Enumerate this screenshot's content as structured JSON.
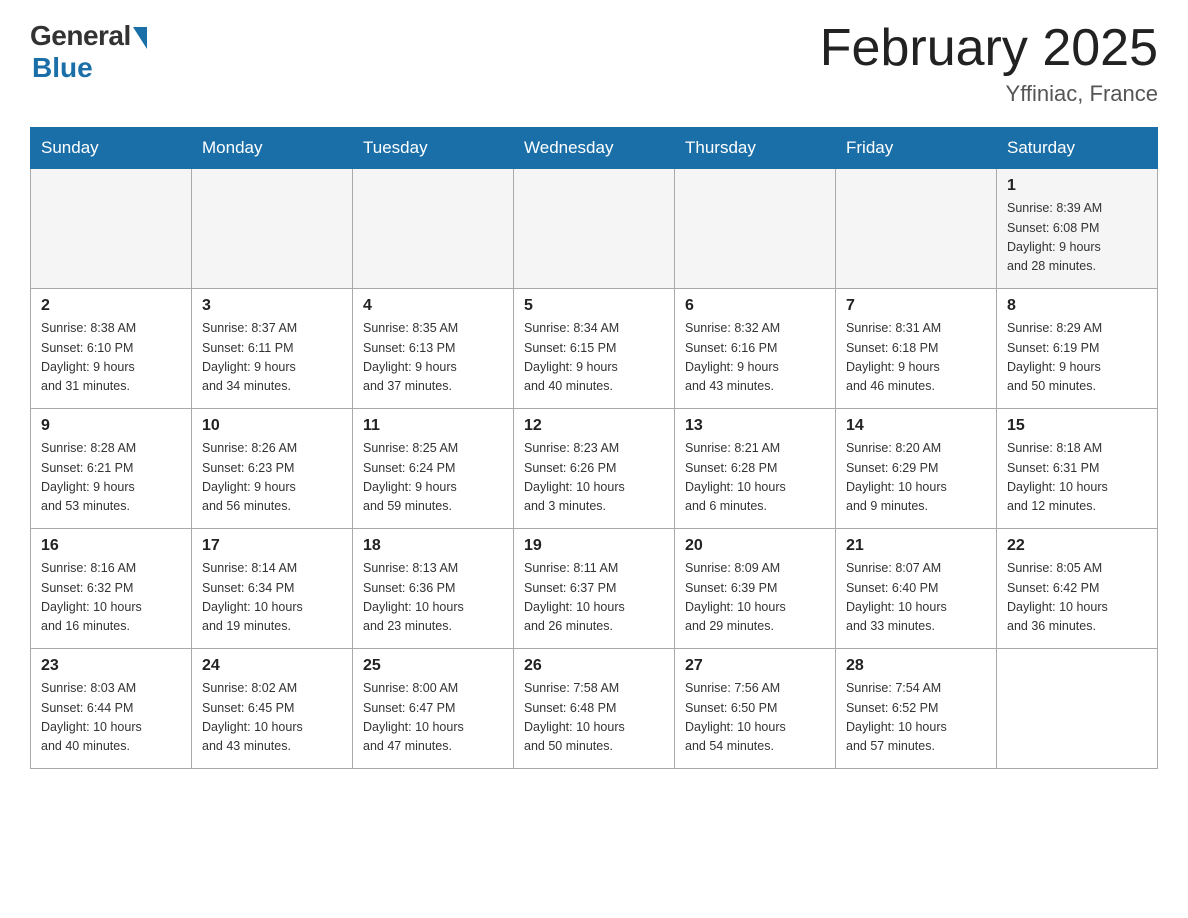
{
  "header": {
    "logo_general": "General",
    "logo_blue": "Blue",
    "month_title": "February 2025",
    "location": "Yffiniac, France"
  },
  "days_of_week": [
    "Sunday",
    "Monday",
    "Tuesday",
    "Wednesday",
    "Thursday",
    "Friday",
    "Saturday"
  ],
  "weeks": [
    {
      "days": [
        {
          "number": "",
          "info": ""
        },
        {
          "number": "",
          "info": ""
        },
        {
          "number": "",
          "info": ""
        },
        {
          "number": "",
          "info": ""
        },
        {
          "number": "",
          "info": ""
        },
        {
          "number": "",
          "info": ""
        },
        {
          "number": "1",
          "info": "Sunrise: 8:39 AM\nSunset: 6:08 PM\nDaylight: 9 hours\nand 28 minutes."
        }
      ]
    },
    {
      "days": [
        {
          "number": "2",
          "info": "Sunrise: 8:38 AM\nSunset: 6:10 PM\nDaylight: 9 hours\nand 31 minutes."
        },
        {
          "number": "3",
          "info": "Sunrise: 8:37 AM\nSunset: 6:11 PM\nDaylight: 9 hours\nand 34 minutes."
        },
        {
          "number": "4",
          "info": "Sunrise: 8:35 AM\nSunset: 6:13 PM\nDaylight: 9 hours\nand 37 minutes."
        },
        {
          "number": "5",
          "info": "Sunrise: 8:34 AM\nSunset: 6:15 PM\nDaylight: 9 hours\nand 40 minutes."
        },
        {
          "number": "6",
          "info": "Sunrise: 8:32 AM\nSunset: 6:16 PM\nDaylight: 9 hours\nand 43 minutes."
        },
        {
          "number": "7",
          "info": "Sunrise: 8:31 AM\nSunset: 6:18 PM\nDaylight: 9 hours\nand 46 minutes."
        },
        {
          "number": "8",
          "info": "Sunrise: 8:29 AM\nSunset: 6:19 PM\nDaylight: 9 hours\nand 50 minutes."
        }
      ]
    },
    {
      "days": [
        {
          "number": "9",
          "info": "Sunrise: 8:28 AM\nSunset: 6:21 PM\nDaylight: 9 hours\nand 53 minutes."
        },
        {
          "number": "10",
          "info": "Sunrise: 8:26 AM\nSunset: 6:23 PM\nDaylight: 9 hours\nand 56 minutes."
        },
        {
          "number": "11",
          "info": "Sunrise: 8:25 AM\nSunset: 6:24 PM\nDaylight: 9 hours\nand 59 minutes."
        },
        {
          "number": "12",
          "info": "Sunrise: 8:23 AM\nSunset: 6:26 PM\nDaylight: 10 hours\nand 3 minutes."
        },
        {
          "number": "13",
          "info": "Sunrise: 8:21 AM\nSunset: 6:28 PM\nDaylight: 10 hours\nand 6 minutes."
        },
        {
          "number": "14",
          "info": "Sunrise: 8:20 AM\nSunset: 6:29 PM\nDaylight: 10 hours\nand 9 minutes."
        },
        {
          "number": "15",
          "info": "Sunrise: 8:18 AM\nSunset: 6:31 PM\nDaylight: 10 hours\nand 12 minutes."
        }
      ]
    },
    {
      "days": [
        {
          "number": "16",
          "info": "Sunrise: 8:16 AM\nSunset: 6:32 PM\nDaylight: 10 hours\nand 16 minutes."
        },
        {
          "number": "17",
          "info": "Sunrise: 8:14 AM\nSunset: 6:34 PM\nDaylight: 10 hours\nand 19 minutes."
        },
        {
          "number": "18",
          "info": "Sunrise: 8:13 AM\nSunset: 6:36 PM\nDaylight: 10 hours\nand 23 minutes."
        },
        {
          "number": "19",
          "info": "Sunrise: 8:11 AM\nSunset: 6:37 PM\nDaylight: 10 hours\nand 26 minutes."
        },
        {
          "number": "20",
          "info": "Sunrise: 8:09 AM\nSunset: 6:39 PM\nDaylight: 10 hours\nand 29 minutes."
        },
        {
          "number": "21",
          "info": "Sunrise: 8:07 AM\nSunset: 6:40 PM\nDaylight: 10 hours\nand 33 minutes."
        },
        {
          "number": "22",
          "info": "Sunrise: 8:05 AM\nSunset: 6:42 PM\nDaylight: 10 hours\nand 36 minutes."
        }
      ]
    },
    {
      "days": [
        {
          "number": "23",
          "info": "Sunrise: 8:03 AM\nSunset: 6:44 PM\nDaylight: 10 hours\nand 40 minutes."
        },
        {
          "number": "24",
          "info": "Sunrise: 8:02 AM\nSunset: 6:45 PM\nDaylight: 10 hours\nand 43 minutes."
        },
        {
          "number": "25",
          "info": "Sunrise: 8:00 AM\nSunset: 6:47 PM\nDaylight: 10 hours\nand 47 minutes."
        },
        {
          "number": "26",
          "info": "Sunrise: 7:58 AM\nSunset: 6:48 PM\nDaylight: 10 hours\nand 50 minutes."
        },
        {
          "number": "27",
          "info": "Sunrise: 7:56 AM\nSunset: 6:50 PM\nDaylight: 10 hours\nand 54 minutes."
        },
        {
          "number": "28",
          "info": "Sunrise: 7:54 AM\nSunset: 6:52 PM\nDaylight: 10 hours\nand 57 minutes."
        },
        {
          "number": "",
          "info": ""
        }
      ]
    }
  ]
}
